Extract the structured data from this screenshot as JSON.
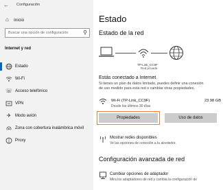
{
  "window": {
    "title": "Configuración"
  },
  "sidebar": {
    "home": "Inicio",
    "search_placeholder": "Buscar una opción de configuración",
    "section": "Internet y red",
    "items": [
      {
        "label": "Estado",
        "icon": "globe-icon"
      },
      {
        "label": "Wi-Fi",
        "icon": "wifi-icon"
      },
      {
        "label": "Acceso telefónico",
        "icon": "phone-icon"
      },
      {
        "label": "VPN",
        "icon": "vpn-icon"
      },
      {
        "label": "Modo avión",
        "icon": "airplane-icon"
      },
      {
        "label": "Zona con cobertura inalámbrica móvil",
        "icon": "hotspot-icon"
      },
      {
        "label": "Proxy",
        "icon": "proxy-icon"
      }
    ]
  },
  "main": {
    "title": "Estado",
    "network_status_heading": "Estado de la red",
    "network_name": "TP-Link_CC9F",
    "network_type": "Red privada",
    "connected_heading": "Estás conectado a Internet",
    "connected_text_lines": [
      "Si tienes un plan de datos limitado, puedes definir una conexión",
      "de uso medido para esta red o cambiar otras propiedades."
    ],
    "wifi": {
      "name": "Wi-Fi (TP-Link_CC9F)",
      "since": "Desde los últimos 30 días",
      "usage": "23.98 GB"
    },
    "buttons": {
      "properties": "Propiedades",
      "data_usage": "Uso de datos"
    },
    "show_networks": {
      "title": "Mostrar redes disponibles",
      "subtitle": "Ve las opciones de conexión a tu alrededor."
    },
    "advanced_heading": "Configuración avanzada de red",
    "adapter": {
      "title": "Cambiar opciones de adaptador",
      "subtitle": "Mira los adaptadores de red y cambia la configuración de"
    }
  },
  "colors": {
    "accent": "#0067c0",
    "highlight": "#f07d3a",
    "sidebar_bg": "#f2f2f2",
    "button_bg": "#cccccc"
  }
}
